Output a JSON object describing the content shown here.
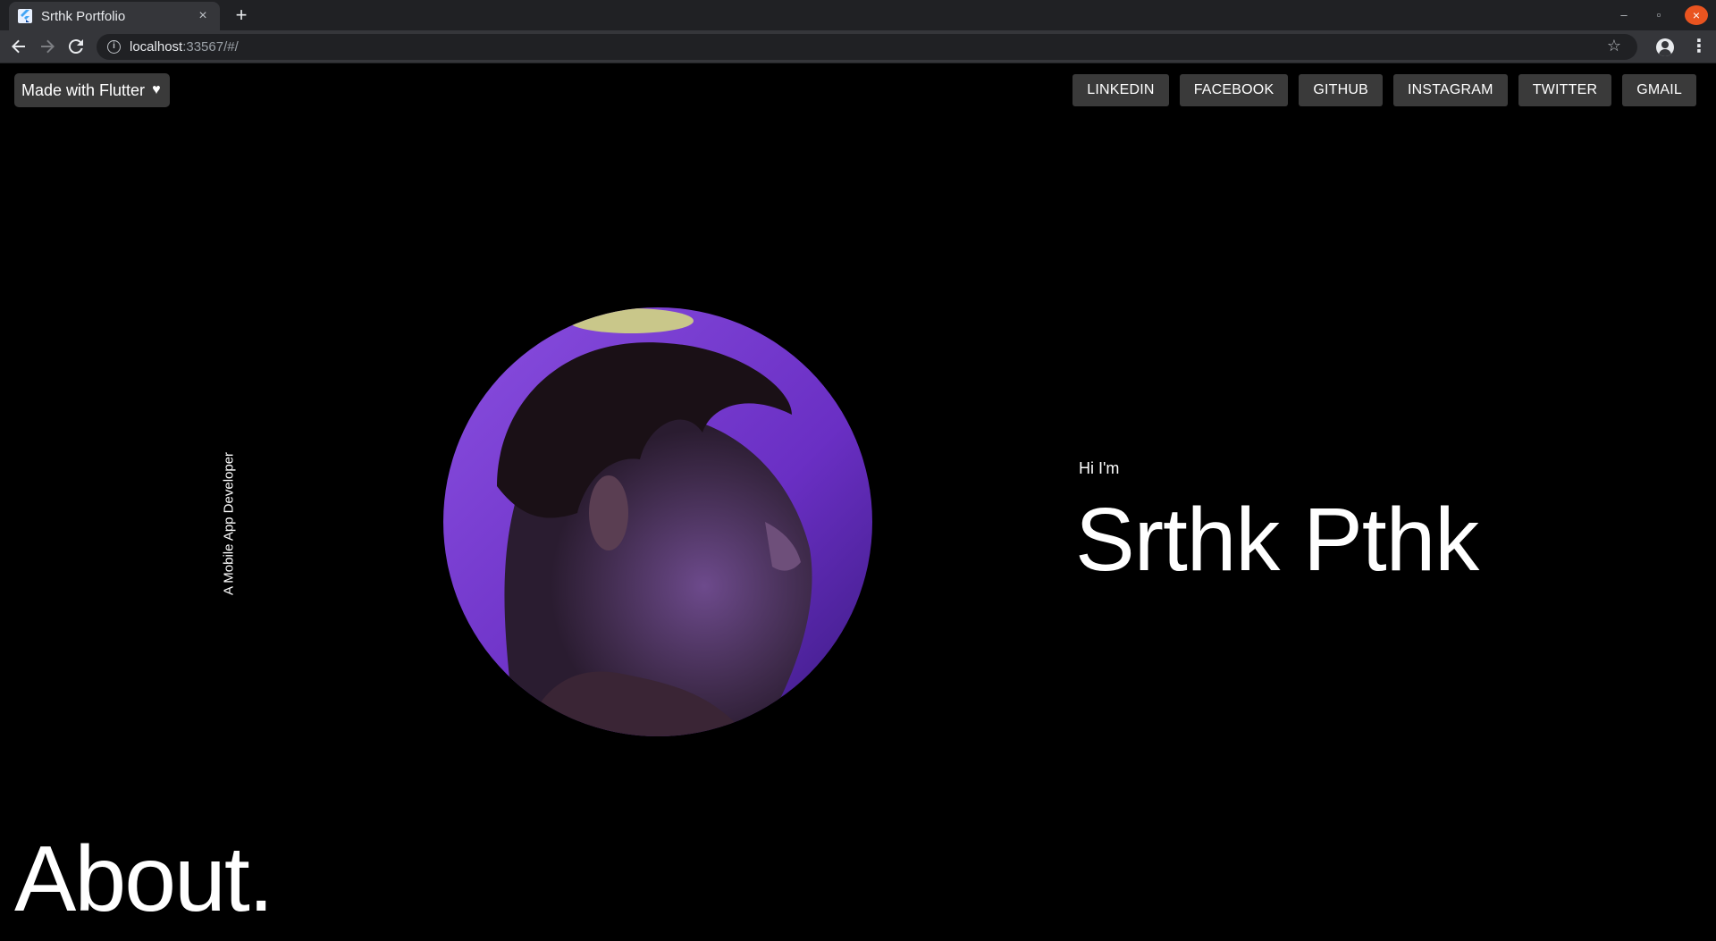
{
  "browser": {
    "tab_title": "Srthk Portfolio",
    "tab_close": "×",
    "new_tab": "+",
    "url_host": "localhost",
    "url_rest": ":33567/#/",
    "window_controls": {
      "minimize": "–",
      "maximize": "▫",
      "close": "×"
    },
    "icons": {
      "back": "arrow-left-icon",
      "forward": "arrow-right-icon",
      "reload": "reload-icon",
      "info": "info-icon",
      "star": "star-icon",
      "profile": "profile-icon",
      "menu": "kebab-menu-icon"
    }
  },
  "page": {
    "badge_label": "Made with Flutter",
    "badge_icon": "♥",
    "social_links": [
      {
        "label": "LINKEDIN"
      },
      {
        "label": "FACEBOOK"
      },
      {
        "label": "GITHUB"
      },
      {
        "label": "INSTAGRAM"
      },
      {
        "label": "TWITTER"
      },
      {
        "label": "GMAIL"
      }
    ],
    "tagline": "A Mobile App Developer",
    "greeting": "Hi I'm",
    "name": "Srthk Pthk",
    "section_title": "About."
  },
  "colors": {
    "page_background": "#000000",
    "button_background": "#3a3a3a",
    "text": "#ffffff",
    "avatar_purple": "#7b3fd6"
  }
}
